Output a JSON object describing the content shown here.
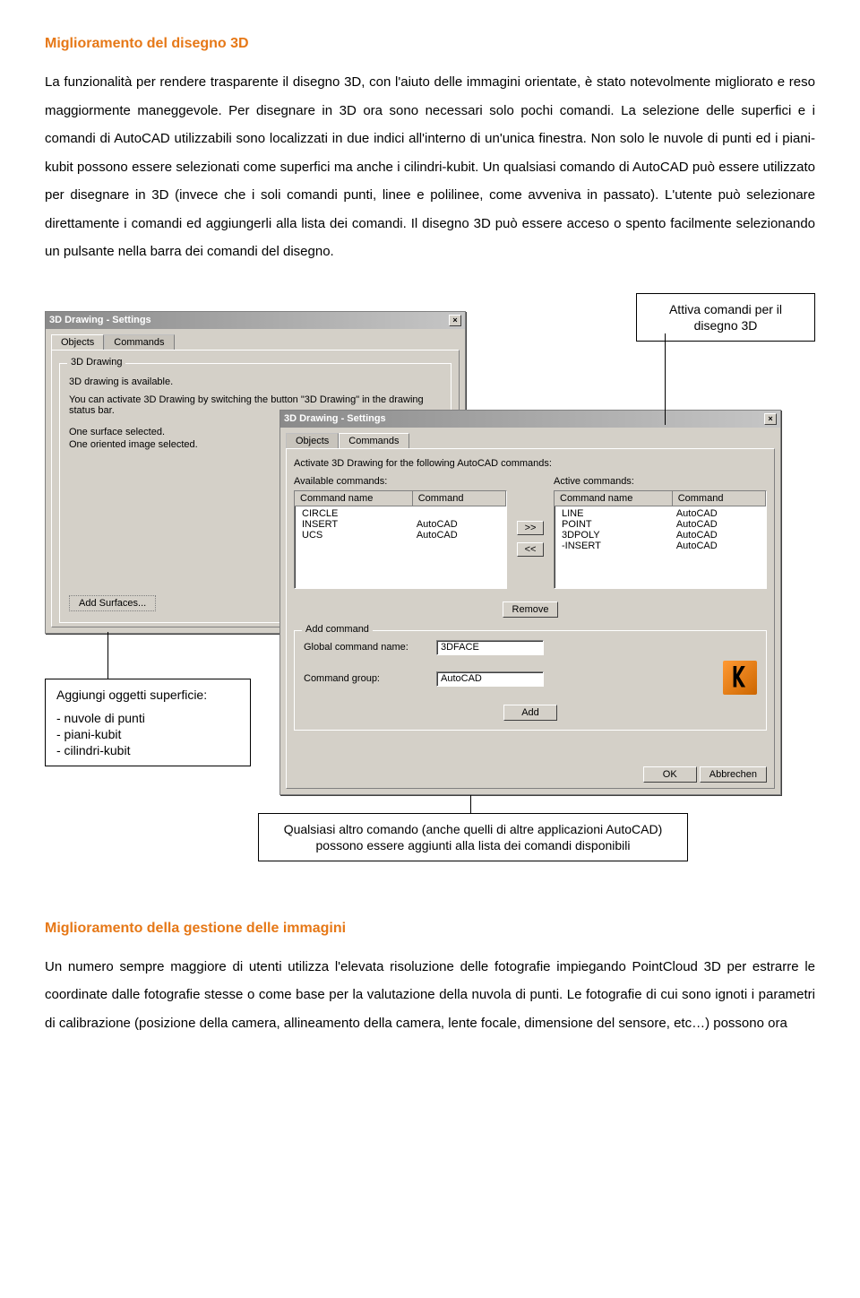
{
  "section1": {
    "title": "Miglioramento del disegno 3D",
    "body": "La funzionalità per rendere trasparente il disegno 3D, con l'aiuto delle immagini orientate, è stato notevolmente migliorato e reso maggiormente maneggevole. Per disegnare in 3D ora sono necessari solo pochi comandi. La selezione delle superfici e i comandi di AutoCAD utilizzabili sono localizzati in due indici all'interno di un'unica finestra. Non solo le nuvole di punti ed i piani-kubit possono essere selezionati come superfici ma anche i cilindri-kubit. Un qualsiasi comando di AutoCAD può essere utilizzato per disegnare in 3D (invece che i soli comandi punti, linee e polilinee, come avveniva in passato). L'utente può selezionare direttamente i comandi ed aggiungerli alla lista dei comandi. Il disegno 3D può essere acceso o spento facilmente selezionando un pulsante nella barra dei comandi del disegno."
  },
  "win1": {
    "title": "3D Drawing - Settings",
    "tab_objects": "Objects",
    "tab_commands": "Commands",
    "group": "3D Drawing",
    "line1": "3D drawing is available.",
    "line2": "You can activate 3D Drawing by switching the button \"3D Drawing\" in the drawing status bar.",
    "line3": "One surface selected.",
    "line4": "One oriented image selected.",
    "btn_add": "Add Surfaces..."
  },
  "win2": {
    "title": "3D Drawing - Settings",
    "tab_objects": "Objects",
    "tab_commands": "Commands",
    "subtitle": "Activate 3D Drawing for the following AutoCAD commands:",
    "avail_label": "Available commands:",
    "active_label": "Active commands:",
    "col_name": "Command name",
    "col_cmd": "Command",
    "avail": [
      {
        "n": "CIRCLE",
        "c": ""
      },
      {
        "n": "INSERT",
        "c": "AutoCAD"
      },
      {
        "n": "UCS",
        "c": "AutoCAD"
      }
    ],
    "active": [
      {
        "n": "LINE",
        "c": "AutoCAD"
      },
      {
        "n": "POINT",
        "c": "AutoCAD"
      },
      {
        "n": "3DPOLY",
        "c": "AutoCAD"
      },
      {
        "n": "-INSERT",
        "c": "AutoCAD"
      }
    ],
    "btn_right": ">>",
    "btn_left": "<<",
    "btn_remove": "Remove",
    "addcmd_label": "Add command",
    "global_label": "Global command name:",
    "global_val": "3DFACE",
    "group_label": "Command group:",
    "group_val": "AutoCAD",
    "btn_add": "Add",
    "btn_ok": "OK",
    "btn_cancel": "Abbrechen"
  },
  "callouts": {
    "c1": "Attiva comandi per il disegno 3D",
    "c2_title": "Aggiungi oggetti superficie:",
    "c2_items": [
      "- nuvole di punti",
      "- piani-kubit",
      "- cilindri-kubit"
    ],
    "c3": "Qualsiasi altro comando (anche quelli di altre applicazioni AutoCAD) possono essere aggiunti alla lista dei comandi disponibili"
  },
  "section2": {
    "title": "Miglioramento della gestione delle immagini",
    "body": "Un numero sempre maggiore di utenti utilizza l'elevata risoluzione delle fotografie impiegando PointCloud 3D per estrarre le coordinate dalle fotografie stesse o come base per la valutazione della nuvola di punti. Le fotografie di cui sono ignoti i parametri di calibrazione (posizione della camera, allineamento della camera, lente focale, dimensione del sensore, etc…) possono ora"
  }
}
